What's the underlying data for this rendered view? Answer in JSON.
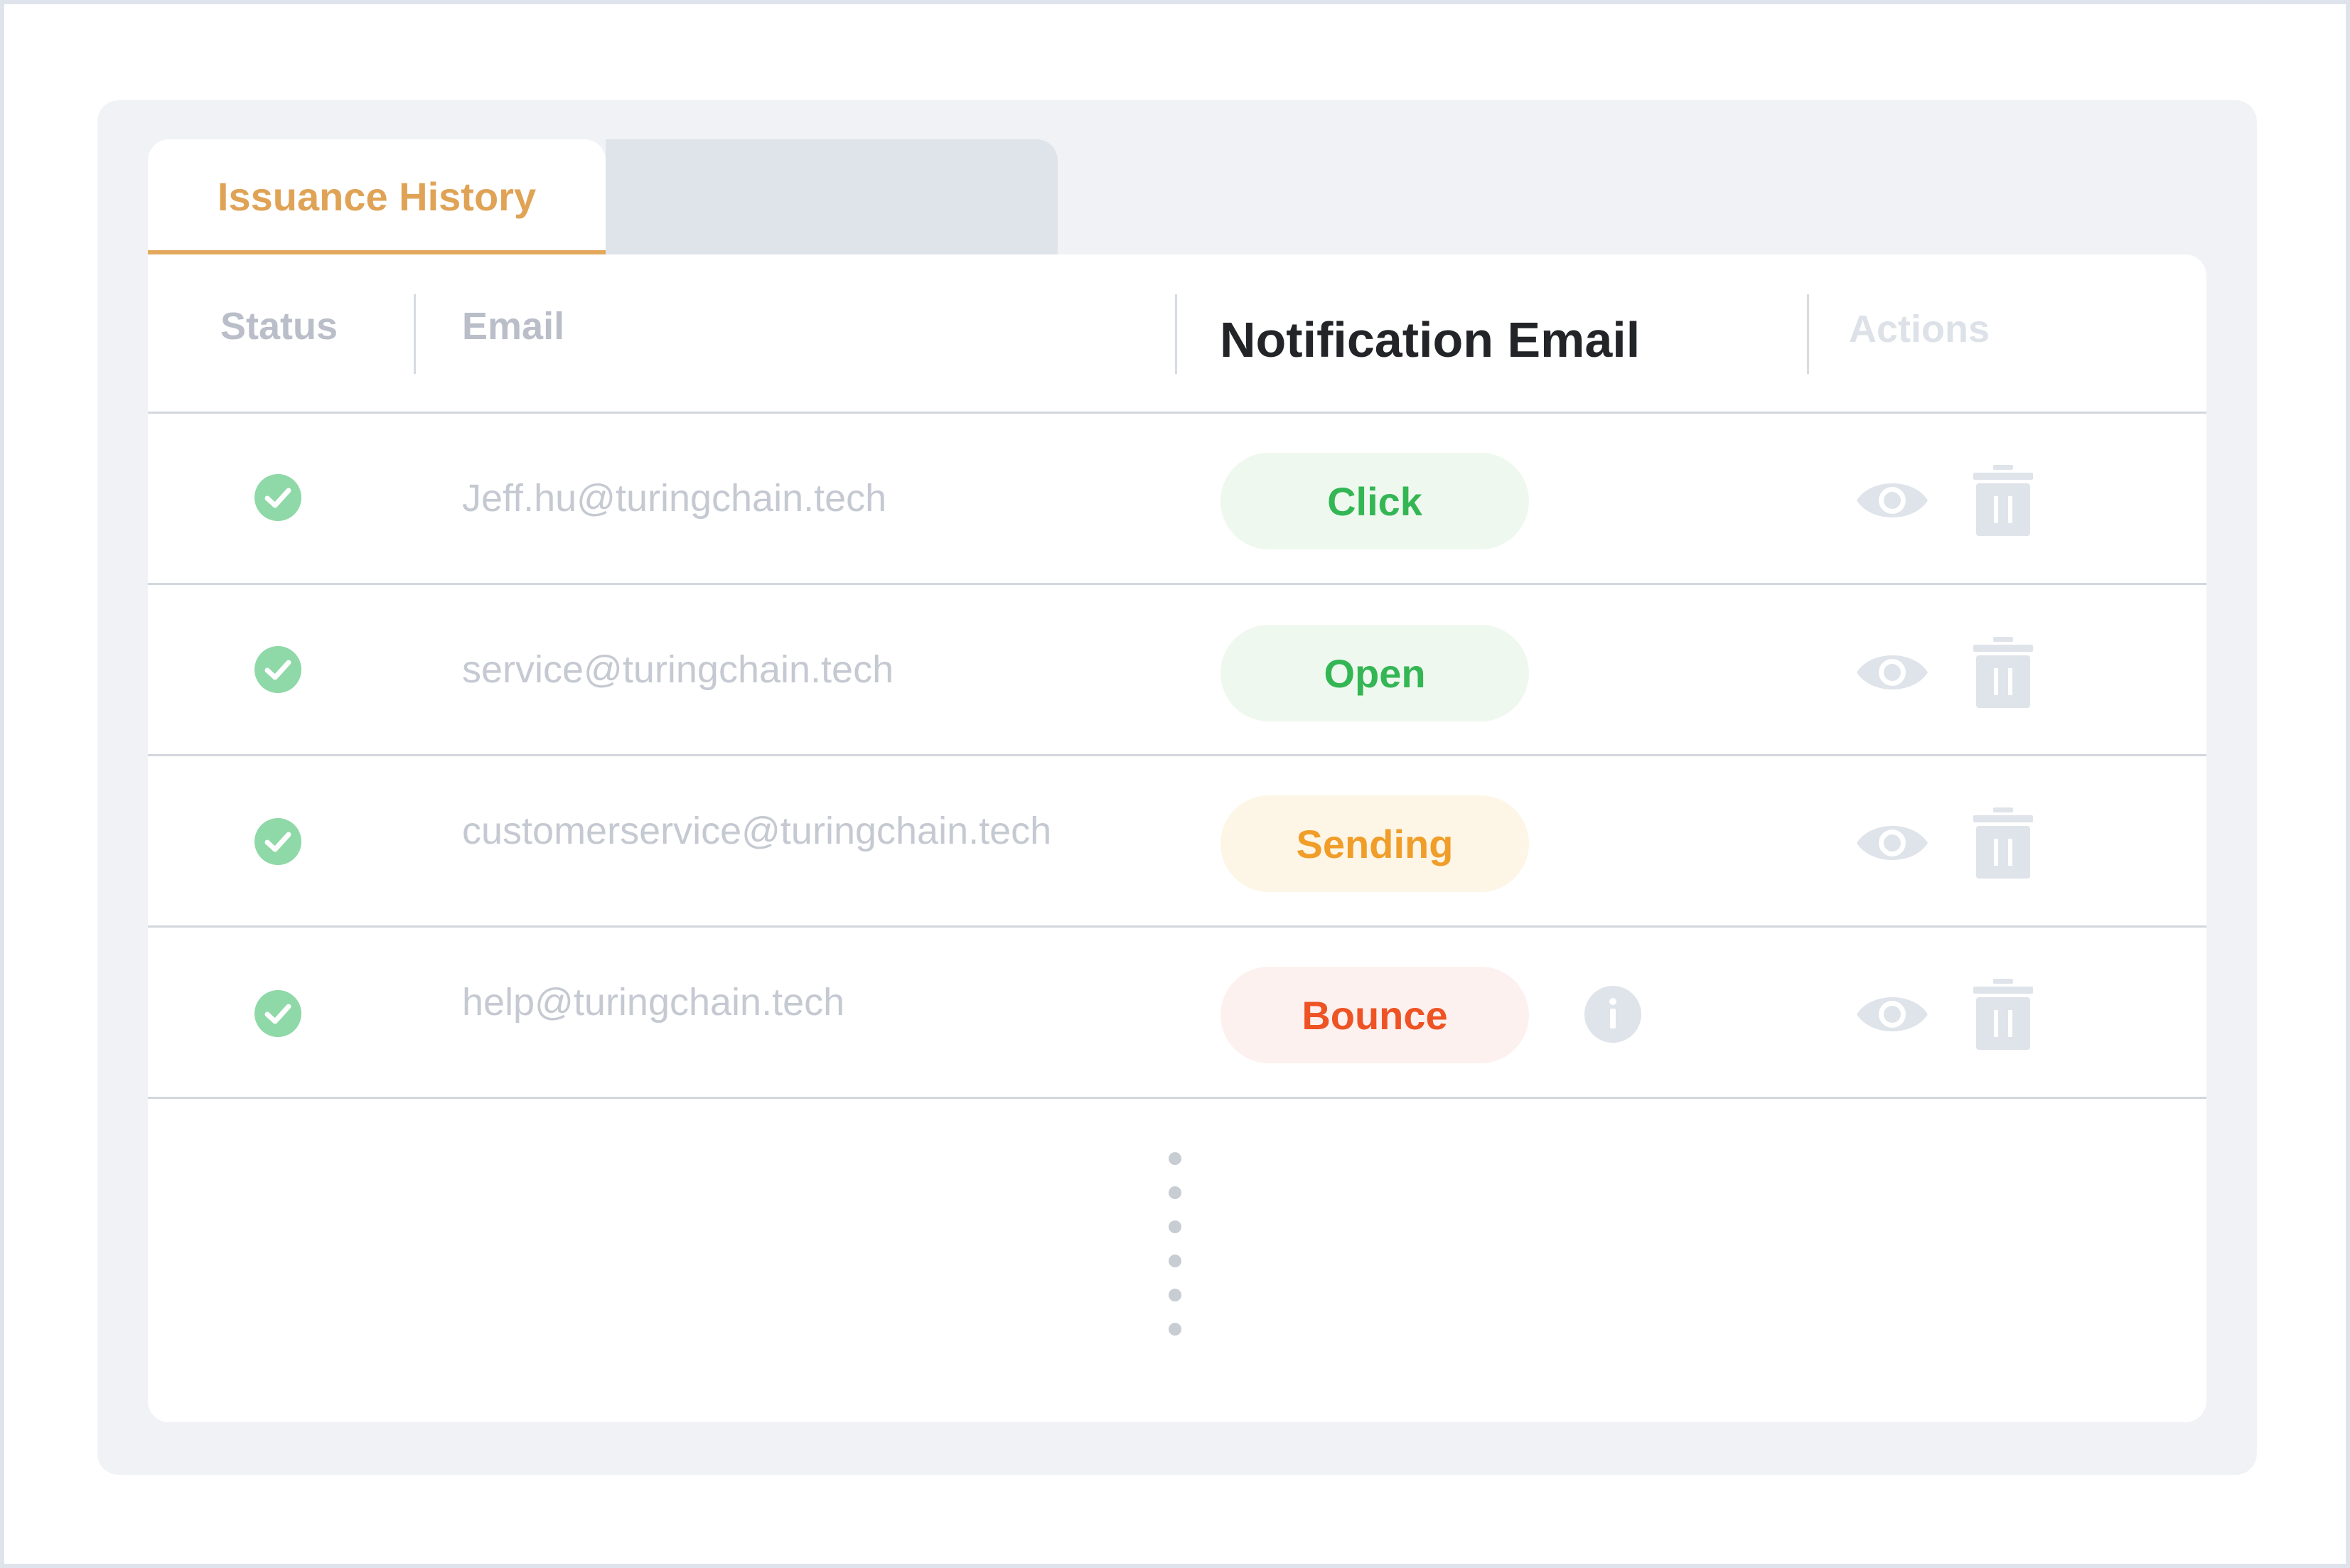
{
  "tabs": [
    {
      "label": "Issuance History",
      "active": true
    },
    {
      "label": "",
      "active": false
    }
  ],
  "table": {
    "columns": {
      "status": "Status",
      "email": "Email",
      "notification": "Notification Email",
      "actions": "Actions"
    },
    "rows": [
      {
        "status": "check-circle-icon",
        "email": "Jeff.hu@turingchain.tech",
        "notification": "Click",
        "notification_color": "#34b654",
        "has_info": false
      },
      {
        "status": "check-circle-icon",
        "email": "service@turingchain.tech",
        "notification": "Open",
        "notification_color": "#34b654",
        "has_info": false
      },
      {
        "status": "check-circle-icon",
        "email": "customerservice@turingchain.tech",
        "notification": "Sending",
        "notification_color": "#f09d2a",
        "has_info": false
      },
      {
        "status": "check-circle-icon",
        "email": "help@turingchain.tech",
        "notification": "Bounce",
        "notification_color": "#ee5324",
        "has_info": true
      }
    ],
    "more_indicator": "vertical-ellipsis-icon"
  },
  "colors": {
    "accent": "#e0a356",
    "success": "#34b654",
    "warning": "#f09d2a",
    "danger": "#ee5324",
    "check": "#8fd8a7"
  }
}
